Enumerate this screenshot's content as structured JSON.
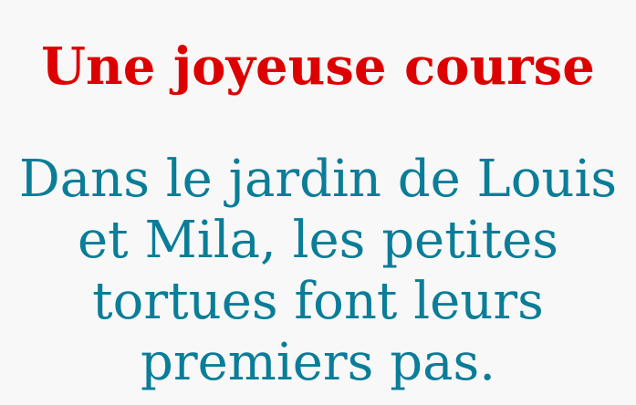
{
  "title": "Une joyeuse course",
  "body_lines": [
    "Dans le jardin de Louis",
    "et Mila, les petites",
    "tortues font leurs",
    "premiers pas."
  ],
  "colors": {
    "title": "#dd0000",
    "body": "#0a7d98",
    "background": "#f8f8f8"
  }
}
